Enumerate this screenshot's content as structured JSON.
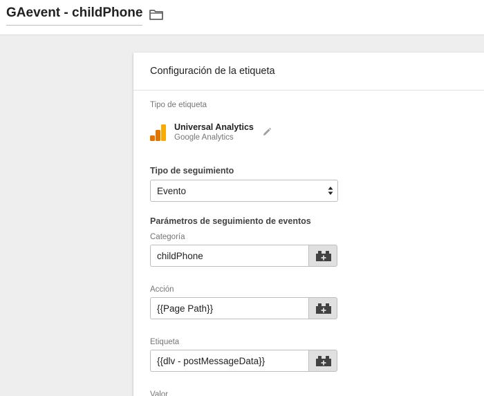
{
  "header": {
    "tag_name": "GAevent - childPhone",
    "folder_icon": "folder-icon"
  },
  "card": {
    "title": "Configuración de la etiqueta",
    "tag_type_label": "Tipo de etiqueta",
    "tag_type": {
      "name": "Universal Analytics",
      "vendor": "Google Analytics",
      "icon": "google-analytics-logo",
      "edit_icon": "pencil-icon"
    },
    "tracking_type": {
      "label": "Tipo de seguimiento",
      "value": "Evento"
    },
    "event_params_title": "Parámetros de seguimiento de eventos",
    "fields": {
      "category": {
        "label": "Categoría",
        "value": "childPhone"
      },
      "action": {
        "label": "Acción",
        "value": "{{Page Path}}"
      },
      "label": {
        "label": "Etiqueta",
        "value": "{{dlv - postMessageData}}"
      },
      "value": {
        "label": "Valor"
      }
    },
    "variable_picker_icon": "lego-brick-plus-icon"
  },
  "colors": {
    "ga_orange_dark": "#e37400",
    "ga_orange_light": "#f9ab00",
    "background": "#eeeeee",
    "button_bg": "#e0e0e0"
  }
}
